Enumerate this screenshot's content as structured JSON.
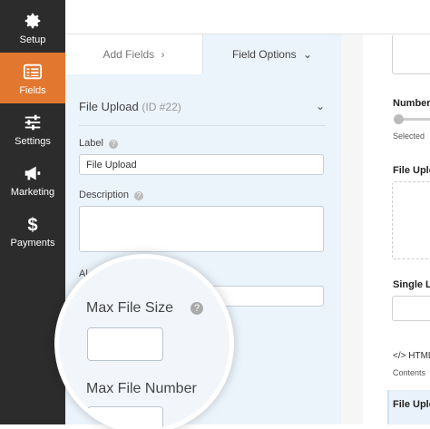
{
  "sidebar": {
    "items": [
      {
        "label": "Setup"
      },
      {
        "label": "Fields"
      },
      {
        "label": "Settings"
      },
      {
        "label": "Marketing"
      },
      {
        "label": "Payments"
      }
    ]
  },
  "tabs": {
    "add_fields": "Add Fields",
    "add_fields_chevron": "›",
    "field_options": "Field Options",
    "field_options_chevron": "⌄"
  },
  "field": {
    "title": "File Upload",
    "id": "(ID #22)",
    "label_label": "Label",
    "label_value": "File Upload",
    "description_label": "Description",
    "description_value": "",
    "partial_label": "Al",
    "max_file_size_label": "Max File Size",
    "max_file_number_label": "Max File Number"
  },
  "preview": {
    "number_label": "Number",
    "selected_text": "Selected",
    "file_upload_label": "File Uple",
    "single_label": "Single L",
    "html_label": "HTML",
    "html_chevrons": "</>",
    "contents_label": "Contents",
    "file_upload_label_2": "File Uple"
  },
  "colors": {
    "sidebar_bg": "#2c2c2c",
    "active_accent": "#e27730",
    "panel_bg": "#ebf3fb"
  }
}
